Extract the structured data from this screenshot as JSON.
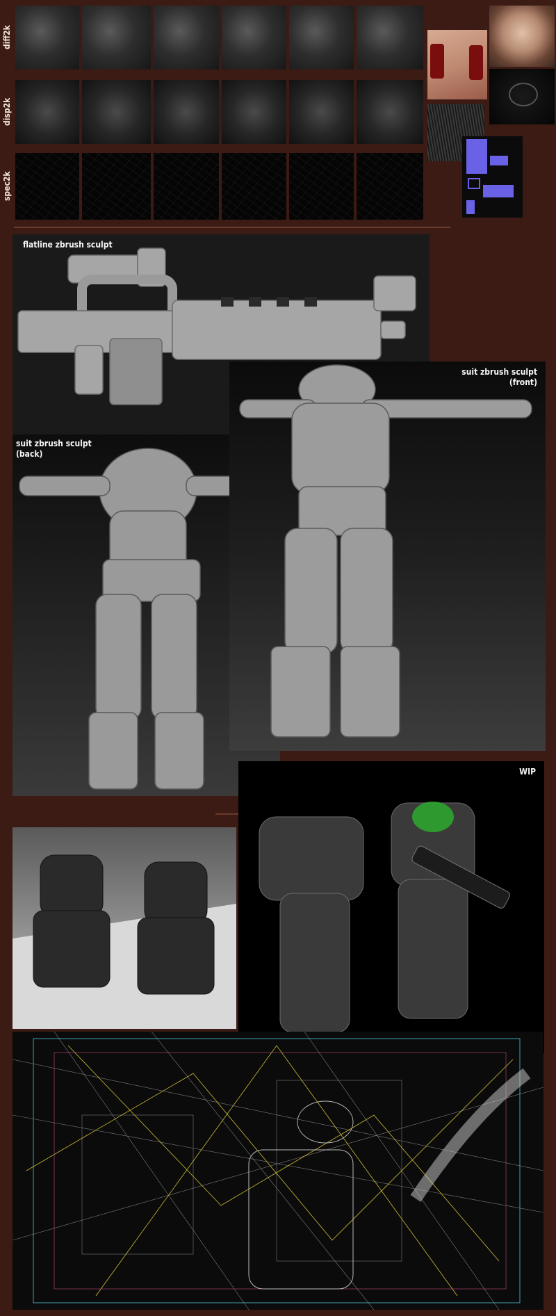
{
  "rows": {
    "diff": {
      "label": "diff2k"
    },
    "disp": {
      "label": "disp2k"
    },
    "spec": {
      "label": "spec2k"
    }
  },
  "captions": {
    "gun": "flatline zbrush sculpt",
    "suit_front": "suit zbrush sculpt\n(front)",
    "suit_back": "suit zbrush sculpt\n(back)",
    "wip": "WIP"
  },
  "colors": {
    "background": "#3b1b13",
    "divider": "#6b3a2a",
    "normal_map": "#6a62e6",
    "skin_map": "#c49a86",
    "weapon_glow": "#29c229"
  },
  "icons": {
    "gun": "rifle-render",
    "suit": "armor-suit-render",
    "wireframe": "wireframe-scene-render"
  }
}
